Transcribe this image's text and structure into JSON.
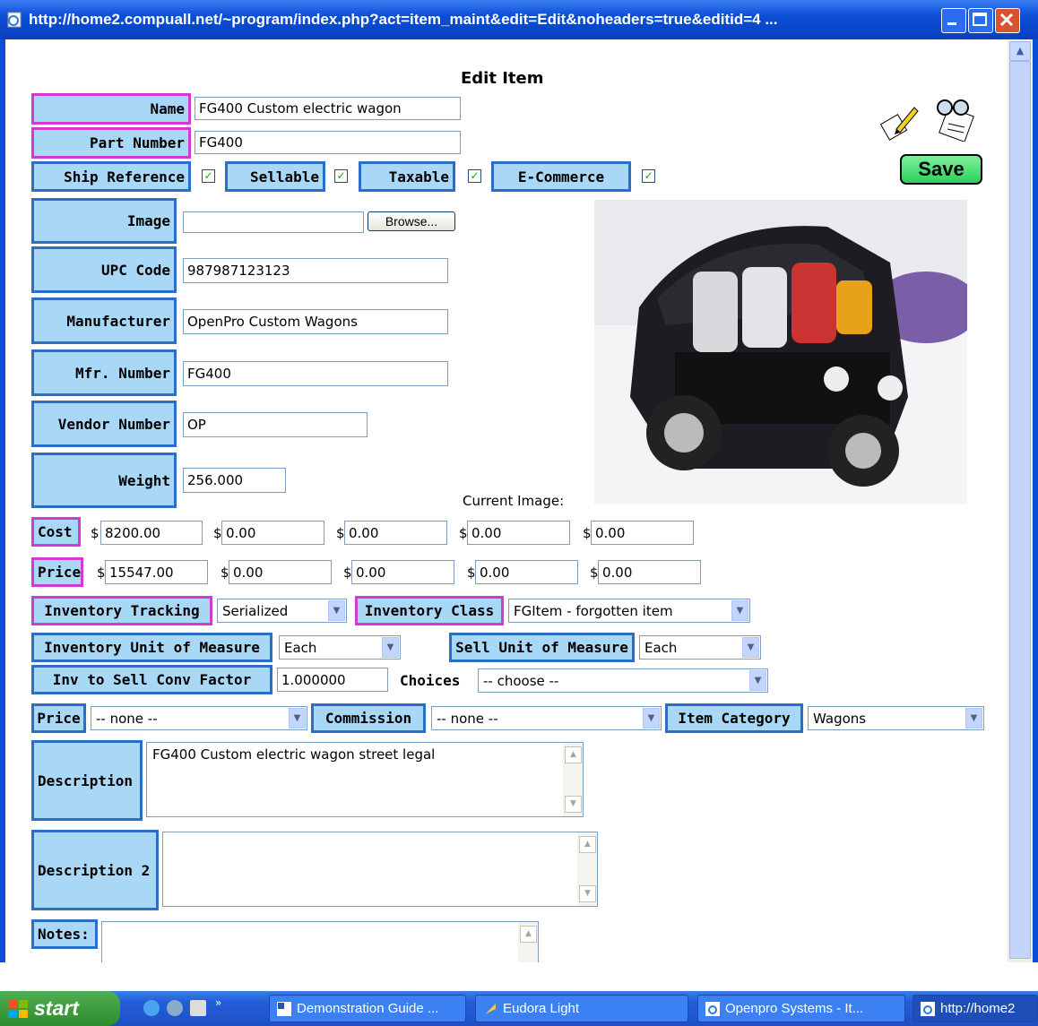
{
  "window": {
    "title": "http://home2.compuall.net/~program/index.php?act=item_maint&edit=Edit&noheaders=true&editid=4 ..."
  },
  "form": {
    "heading": "Edit Item",
    "save_label": "Save",
    "name_label": "Name",
    "name_value": "FG400  Custom electric wagon",
    "part_label": "Part Number",
    "part_value": "FG400",
    "ship_label": "Ship Reference",
    "sellable_label": "Sellable",
    "taxable_label": "Taxable",
    "ecommerce_label": "E-Commerce",
    "checked_glyph": "✓",
    "image_label": "Image",
    "browse_label": "Browse...",
    "upc_label": "UPC Code",
    "upc_value": "987987123123",
    "mfr_label": "Manufacturer",
    "mfr_value": "OpenPro Custom Wagons",
    "mfrnum_label": "Mfr. Number",
    "mfrnum_value": "FG400",
    "vendor_label": "Vendor Number",
    "vendor_value": "OP",
    "weight_label": "Weight",
    "weight_value": "256.000",
    "current_image_label": "Current Image:",
    "cost_label": "Cost",
    "cost_values": [
      "8200.00",
      "0.00",
      "0.00",
      "0.00",
      "0.00"
    ],
    "price_label": "Price",
    "price_values": [
      "15547.00",
      "0.00",
      "0.00",
      "0.00",
      "0.00"
    ],
    "currency": "$",
    "inv_tracking_label": "Inventory Tracking",
    "inv_tracking_value": "Serialized",
    "inv_class_label": "Inventory Class",
    "inv_class_value": "FGItem - forgotten item",
    "inv_uom_label": "Inventory Unit of Measure",
    "inv_uom_value": "Each",
    "sell_uom_label": "Sell Unit of Measure",
    "sell_uom_value": "Each",
    "conv_label": "Inv to Sell Conv Factor",
    "conv_value": "1.000000",
    "choices_label": "Choices",
    "choices_value": "-- choose --",
    "price_level_label": "Price",
    "price_level_value": "-- none --",
    "commission_label": "Commission",
    "commission_value": "-- none --",
    "category_label": "Item Category",
    "category_value": "Wagons",
    "desc_label": "Description",
    "desc_value": "FG400  Custom electric wagon street legal",
    "desc2_label": "Description 2",
    "desc2_value": "",
    "notes_label": "Notes:",
    "notes_value": ""
  },
  "taskbar": {
    "start_label": "start",
    "items": [
      "Demonstration Guide ...",
      "Eudora Light",
      "Openpro Systems - It...",
      "http://home2"
    ]
  },
  "colors": {
    "label_bg": "#a9d8f7",
    "label_border": "#2a6ec8",
    "required_border": "#d23bd2",
    "save_bg": "#2bd15a"
  }
}
